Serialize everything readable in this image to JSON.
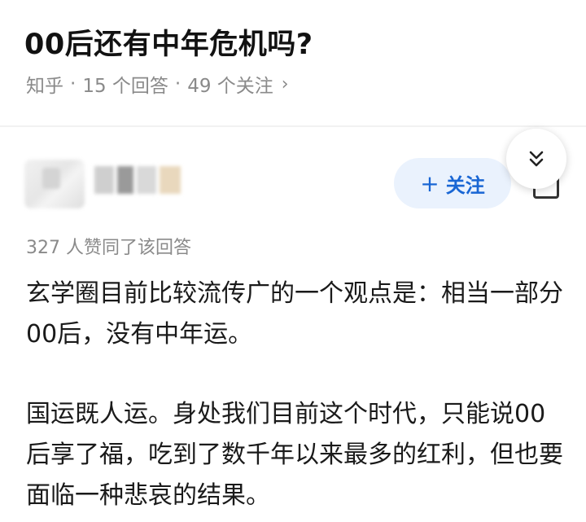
{
  "question": {
    "title": "00后还有中年危机吗?",
    "source": "知乎",
    "separator": "·",
    "answers": "15 个回答",
    "followers": "49 个关注",
    "chevron": "›"
  },
  "answer": {
    "follow_plus": "+",
    "follow_label": "关注",
    "vote_info": "327 人赞同了该回答",
    "paragraphs": [
      "玄学圈目前比较流传广的一个观点是：相当一部分00后，没有中年运。",
      "国运既人运。身处我们目前这个时代，只能说00后享了福，吃到了数千年以来最多的红利，但也要面临一种悲哀的结果。"
    ]
  },
  "icons": {
    "collapse": "double-chevron-down-icon",
    "more": "more-box-icon"
  },
  "colors": {
    "accent": "#1966d4",
    "follow_bg": "#eaf2fd",
    "meta_gray": "#8a8a8a"
  }
}
